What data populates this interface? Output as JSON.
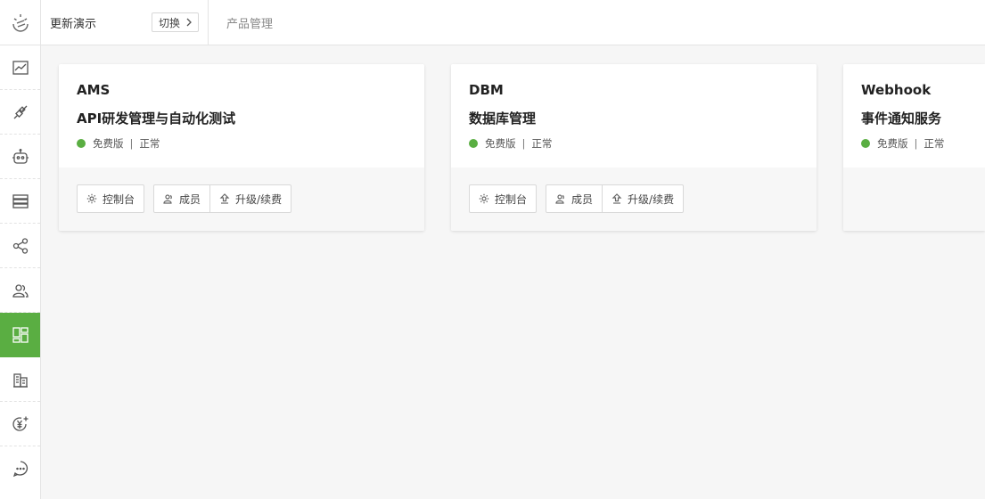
{
  "header": {
    "workspace_name": "更新演示",
    "switch_label": "切换",
    "breadcrumb": "产品管理"
  },
  "sidebar": {
    "active_index": 6,
    "items": [
      {
        "icon": "chart-icon"
      },
      {
        "icon": "api-plug-icon"
      },
      {
        "icon": "robot-icon"
      },
      {
        "icon": "database-icon"
      },
      {
        "icon": "share-icon"
      },
      {
        "icon": "team-icon"
      },
      {
        "icon": "dashboard-icon"
      },
      {
        "icon": "building-icon"
      },
      {
        "icon": "yuan-plus-icon"
      },
      {
        "icon": "chat-icon"
      }
    ]
  },
  "cards": [
    {
      "code": "AMS",
      "title": "API研发管理与自动化测试",
      "plan": "免费版",
      "state": "正常",
      "console_label": "控制台",
      "members_label": "成员",
      "upgrade_label": "升级/续费"
    },
    {
      "code": "DBM",
      "title": "数据库管理",
      "plan": "免费版",
      "state": "正常",
      "console_label": "控制台",
      "members_label": "成员",
      "upgrade_label": "升级/续费"
    },
    {
      "code": "Webhook",
      "title": "事件通知服务",
      "plan": "免费版",
      "state": "正常"
    }
  ],
  "colors": {
    "accent": "#5aae42",
    "status_ok": "#5aae42"
  }
}
